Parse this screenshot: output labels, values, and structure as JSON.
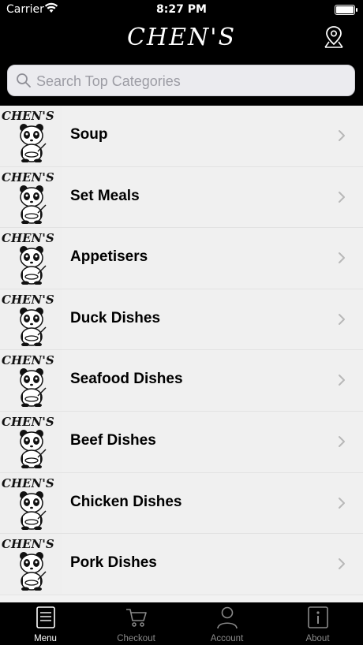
{
  "status": {
    "carrier": "Carrier",
    "time": "8:27 PM"
  },
  "header": {
    "title": "CHEN'S"
  },
  "search": {
    "placeholder": "Search Top Categories"
  },
  "thumbnail": {
    "logo_text": "CHEN'S"
  },
  "categories": [
    {
      "label": "Soup"
    },
    {
      "label": "Set Meals"
    },
    {
      "label": "Appetisers"
    },
    {
      "label": "Duck Dishes"
    },
    {
      "label": "Seafood Dishes"
    },
    {
      "label": "Beef Dishes"
    },
    {
      "label": "Chicken Dishes"
    },
    {
      "label": "Pork Dishes"
    }
  ],
  "tabs": [
    {
      "label": "Menu",
      "icon": "menu-icon",
      "active": true
    },
    {
      "label": "Checkout",
      "icon": "cart-icon",
      "active": false
    },
    {
      "label": "Account",
      "icon": "person-icon",
      "active": false
    },
    {
      "label": "About",
      "icon": "info-icon",
      "active": false
    }
  ],
  "colors": {
    "bar_bg": "#000000",
    "list_bg": "#f0f0f0",
    "active_tab": "#ffffff",
    "inactive_tab": "#8a8a8a"
  }
}
